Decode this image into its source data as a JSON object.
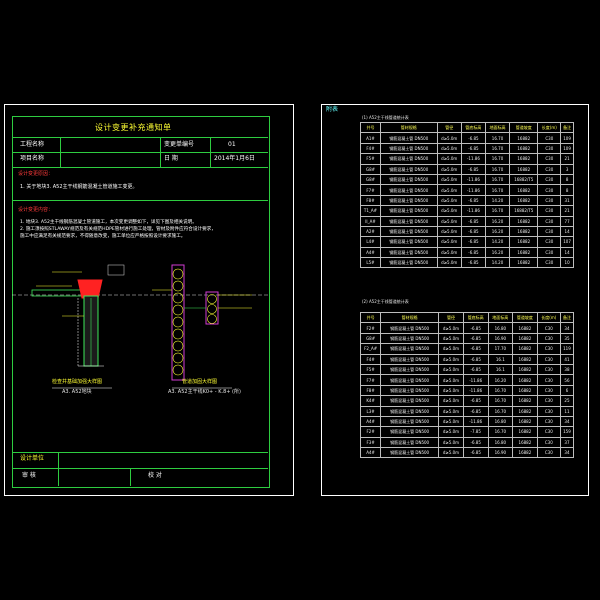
{
  "left_sheet": {
    "title": "设计变更补充通知单",
    "row1": {
      "label_a": "工程名称",
      "label_b": "变更单编号",
      "value_b": "01"
    },
    "row2": {
      "label_a": "项目名称",
      "label_b": "日    期",
      "value_b": "2014年1月6日"
    },
    "section1_heading": "设计变更原因：",
    "section1_text": "1. 关于地块3. A52主干线钢筋混凝土管道施工变更。",
    "section2_heading": "设计变更内容：",
    "section2_lines": [
      "1. 地块3. A52主干线钢筋混凝土管道施工，本次变更调整如下，详见下图及相关说明。",
      "2. 施工须按照STLAWAY规范及有关规范HDPE管材进行施工处理，管材及附件应符合设计要求，",
      "   施工中应满足有关规范要求，不得随意改变，施工单位应严格按照设计要求施工。"
    ],
    "fig1_caption": "检查井基础加强大样图",
    "fig1_sub": "A3. A52地块",
    "fig2_caption": "管道加固大样图",
    "fig2_sub": "A3. A52主干线K0+ - K.8+ (所)",
    "bottom_left": "设计单位",
    "sign_a": "审    核",
    "sign_b": "校    对"
  },
  "right_sheet": {
    "label": "附表",
    "table1_title": "(1) A52主干线管道统计表",
    "table2_title": "(2) A52主干线管道统计表",
    "headers": [
      "井号",
      "管材规格",
      "管径",
      "管底标高",
      "地面标高",
      "管道坡度",
      "长度(m)",
      "备注"
    ],
    "table1_rows": [
      [
        "A1#",
        "钢筋混凝土管 DN500",
        "d≥5.0m",
        "-6.85",
        "16.70",
        "16882",
        "C30",
        "109"
      ],
      [
        "F4#",
        "钢筋混凝土管 DN500",
        "d≥5.0m",
        "-6.85",
        "16.70",
        "16882",
        "C30",
        "109"
      ],
      [
        "F5#",
        "钢筋混凝土管 DN500",
        "d≥5.0m",
        "-11.86",
        "16.70",
        "16882",
        "C30",
        "21"
      ],
      [
        "G8#",
        "钢筋混凝土管 DN500",
        "d≥5.0m",
        "-6.85",
        "16.70",
        "16882",
        "C30",
        "3"
      ],
      [
        "G8#",
        "钢筋混凝土管 DN500",
        "d≥5.0m",
        "-11.86",
        "16.70",
        "16882/T5",
        "C30",
        "8"
      ],
      [
        "F7#",
        "钢筋混凝土管 DN500",
        "d≥5.0m",
        "-11.86",
        "16.70",
        "16882",
        "C30",
        "8"
      ],
      [
        "F8#",
        "钢筋混凝土管 DN500",
        "d≥5.0m",
        "-6.85",
        "14.20",
        "16882",
        "C30",
        "31"
      ],
      [
        "T1_A#",
        "钢筋混凝土管 DN500",
        "d≥5.0m",
        "-11.86",
        "16.70",
        "16882/T5",
        "C30",
        "21"
      ],
      [
        "II_A#",
        "钢筋混凝土管 DN500",
        "d≥5.0m",
        "-6.85",
        "16.20",
        "16882",
        "C30",
        "77"
      ],
      [
        "A2#",
        "钢筋混凝土管 DN500",
        "d≥5.0m",
        "-6.85",
        "16.20",
        "16882",
        "C30",
        "14"
      ],
      [
        "L4#",
        "钢筋混凝土管 DN500",
        "d≥5.0m",
        "-6.85",
        "14.20",
        "16882",
        "C30",
        "107"
      ],
      [
        "A4#",
        "钢筋混凝土管 DN500",
        "d≥5.0m",
        "-6.85",
        "16.20",
        "16882",
        "C30",
        "14"
      ],
      [
        "L5#",
        "钢筋混凝土管 DN500",
        "d≥5.0m",
        "-6.85",
        "14.20",
        "16882",
        "C30",
        "10"
      ]
    ],
    "table2_rows": [
      [
        "F2#",
        "钢筋混凝土管 DN500",
        "d≥5.0m",
        "-6.85",
        "16.80",
        "16882",
        "C30",
        "34"
      ],
      [
        "G8#",
        "钢筋混凝土管 DN500",
        "d≥5.0m",
        "-6.85",
        "16.90",
        "16882",
        "C30",
        "35"
      ],
      [
        "F2_A#",
        "钢筋混凝土管 DN500",
        "d≥5.0m",
        "-6.85",
        "17.70",
        "16882",
        "C30",
        "119"
      ],
      [
        "F4#",
        "钢筋混凝土管 DN500",
        "d≥5.0m",
        "-6.85",
        "16.1",
        "16882",
        "C30",
        "41"
      ],
      [
        "F5#",
        "钢筋混凝土管 DN500",
        "d≥5.0m",
        "-6.85",
        "16.1",
        "16882",
        "C30",
        "38"
      ],
      [
        "F7#",
        "钢筋混凝土管 DN500",
        "d≥5.0m",
        "-11.86",
        "16.20",
        "16882",
        "C30",
        "56"
      ],
      [
        "F8#",
        "钢筋混凝土管 DN500",
        "d≥5.0m",
        "-11.86",
        "16.70",
        "16882",
        "C30",
        "6"
      ],
      [
        "K4#",
        "钢筋混凝土管 DN500",
        "d≥5.0m",
        "-6.85",
        "16.70",
        "16882",
        "C30",
        "25"
      ],
      [
        "L3#",
        "钢筋混凝土管 DN500",
        "d≥5.0m",
        "-6.85",
        "16.70",
        "16882",
        "C30",
        "11"
      ],
      [
        "A4#",
        "钢筋混凝土管 DN500",
        "d≥5.0m",
        "-11.86",
        "16.80",
        "16882",
        "C30",
        "34"
      ],
      [
        "F2#",
        "钢筋混凝土管 DN500",
        "d≥5.0m",
        "-7.85",
        "16.70",
        "16882",
        "C30",
        "159"
      ],
      [
        "F3#",
        "钢筋混凝土管 DN500",
        "d≥5.0m",
        "-6.85",
        "16.80",
        "16882",
        "C30",
        "37"
      ],
      [
        "A4#",
        "钢筋混凝土管 DN500",
        "d≥5.0m",
        "-6.85",
        "16.90",
        "16882",
        "C30",
        "34"
      ]
    ]
  },
  "colors": {
    "background": "#000000",
    "frame": "#ffffff",
    "green_lines": "#2ecc40",
    "yellow_text": "#ffff33",
    "red_hatch": "#ff2222",
    "magenta_pipe": "#d23cd2"
  }
}
